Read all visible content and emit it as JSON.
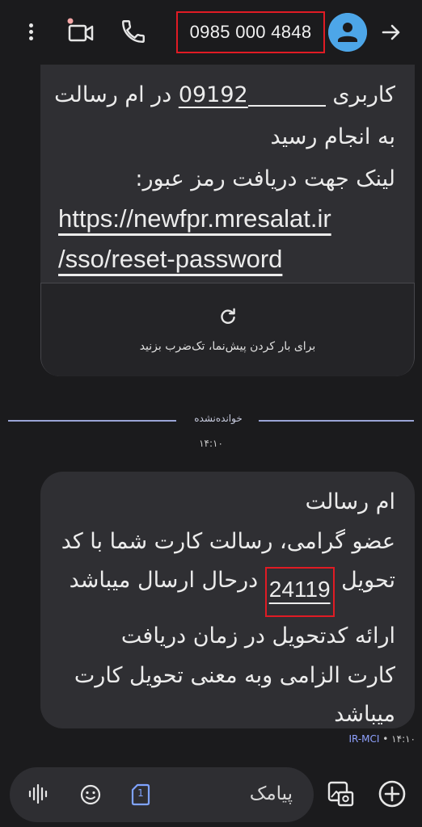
{
  "header": {
    "phone_number": "0985 000 4848",
    "icons": [
      "more-options-icon",
      "video-call-icon",
      "phone-icon",
      "avatar-icon",
      "forward-icon"
    ]
  },
  "messages": {
    "first": {
      "lines": [
        "کاربری",
        "09192",
        "در ام رسالت",
        "به انجام رسید",
        "لینک جهت دریافت رمز عبور:"
      ],
      "link_line1": "https://newfpr.mresalat.ir",
      "link_line2": "/sso/reset-password",
      "preview_text": "برای بار کردن پیش‌نما، تک‌ضرب بزنید"
    },
    "unread_label": "خوانده‌نشده",
    "unread_time": "۱۴:۱۰",
    "second": {
      "lines": [
        "ام رسالت",
        "عضو گرامی، رسالت کارت شما با کد",
        "تحویل",
        "24119",
        "درحال ارسال میباشد",
        "ارائه کدتحویل در زمان دریافت",
        "کارت الزامی وبه معنی تحویل کارت",
        "میباشد"
      ],
      "time": "۱۴:۱۰",
      "sim_label": "IR-MCI"
    }
  },
  "compose": {
    "placeholder": "پیامک",
    "sim_number": "1"
  },
  "colors": {
    "accent_red": "#e01b24",
    "avatar_blue": "#4da6e8",
    "bubble": "#2f2f33",
    "background": "#1b1b1d"
  }
}
